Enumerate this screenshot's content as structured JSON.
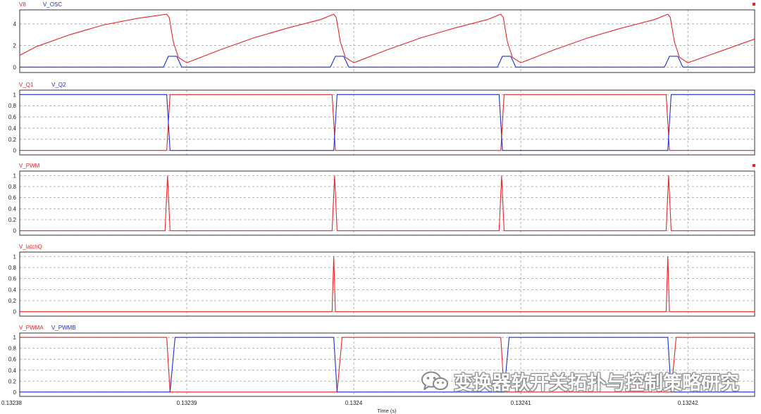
{
  "colors": {
    "red": "#e8262a",
    "blue": "#1f2fd4",
    "grid": "#9a9a9a",
    "axis": "#333333"
  },
  "x_axis": {
    "label": "Time (s)",
    "ticks": [
      "0.13238",
      "0.13239",
      "0.1324",
      "0.13241",
      "0.13242"
    ],
    "tick_values": [
      0.13238,
      0.13239,
      0.1324,
      0.13241,
      0.13242
    ],
    "range": [
      0.13238,
      0.132424
    ]
  },
  "watermark": {
    "text": "变换器软开关拓扑与控制策略研究",
    "icon": "wechat-icon"
  },
  "chart_data": [
    {
      "type": "line",
      "legend": [
        "V8",
        "V_OSC"
      ],
      "ylim": [
        -0.5,
        5.3
      ],
      "y_ticks": [
        "0",
        "2",
        "4"
      ],
      "y_tick_values": [
        0,
        2,
        4
      ],
      "series": [
        {
          "name": "V8",
          "color": "red",
          "points": [
            [
              0.13238,
              1.1
            ],
            [
              0.132381,
              1.9
            ],
            [
              0.132383,
              3.0
            ],
            [
              0.132385,
              3.9
            ],
            [
              0.132387,
              4.5
            ],
            [
              0.1323888,
              4.9
            ],
            [
              0.13238895,
              4.6
            ],
            [
              0.1323892,
              2.3
            ],
            [
              0.1323895,
              0.9
            ],
            [
              0.13239,
              0.4
            ],
            [
              0.132392,
              1.6
            ],
            [
              0.132394,
              2.7
            ],
            [
              0.132396,
              3.6
            ],
            [
              0.132398,
              4.4
            ],
            [
              0.1323988,
              4.9
            ],
            [
              0.13239895,
              4.6
            ],
            [
              0.1323992,
              2.3
            ],
            [
              0.1323995,
              0.9
            ],
            [
              0.1324,
              0.4
            ],
            [
              0.132402,
              1.6
            ],
            [
              0.132404,
              2.7
            ],
            [
              0.132406,
              3.6
            ],
            [
              0.132408,
              4.4
            ],
            [
              0.1324088,
              4.9
            ],
            [
              0.13240895,
              4.6
            ],
            [
              0.1324092,
              2.3
            ],
            [
              0.1324095,
              0.9
            ],
            [
              0.13241,
              0.4
            ],
            [
              0.132412,
              1.6
            ],
            [
              0.132414,
              2.7
            ],
            [
              0.132416,
              3.6
            ],
            [
              0.132418,
              4.4
            ],
            [
              0.1324188,
              4.9
            ],
            [
              0.13241895,
              4.6
            ],
            [
              0.1324192,
              2.3
            ],
            [
              0.1324195,
              0.9
            ],
            [
              0.13242,
              0.4
            ],
            [
              0.132422,
              1.5
            ],
            [
              0.132424,
              2.6
            ]
          ]
        },
        {
          "name": "V_OSC",
          "color": "blue",
          "points": [
            [
              0.13238,
              0
            ],
            [
              0.1323886,
              0
            ],
            [
              0.1323889,
              1.0
            ],
            [
              0.1323894,
              1.0
            ],
            [
              0.1323897,
              0
            ],
            [
              0.1323986,
              0
            ],
            [
              0.1323989,
              1.0
            ],
            [
              0.1323994,
              1.0
            ],
            [
              0.1323997,
              0
            ],
            [
              0.1324086,
              0
            ],
            [
              0.1324089,
              1.0
            ],
            [
              0.1324094,
              1.0
            ],
            [
              0.1324097,
              0
            ],
            [
              0.1324186,
              0
            ],
            [
              0.1324189,
              1.0
            ],
            [
              0.1324194,
              1.0
            ],
            [
              0.1324197,
              0
            ],
            [
              0.132424,
              0
            ]
          ]
        }
      ]
    },
    {
      "type": "line",
      "legend": [
        "V_Q1",
        "V_Q2"
      ],
      "ylim": [
        -0.08,
        1.08
      ],
      "y_ticks": [
        "0",
        "0.2",
        "0.4",
        "0.6",
        "0.8",
        "1"
      ],
      "y_tick_values": [
        0,
        0.2,
        0.4,
        0.6,
        0.8,
        1
      ],
      "series": [
        {
          "name": "V_Q1",
          "color": "red",
          "points": [
            [
              0.13238,
              0
            ],
            [
              0.1323888,
              0
            ],
            [
              0.132389,
              1
            ],
            [
              0.1323987,
              1
            ],
            [
              0.1323989,
              0
            ],
            [
              0.1324088,
              0
            ],
            [
              0.132409,
              1
            ],
            [
              0.1324187,
              1
            ],
            [
              0.1324189,
              0
            ],
            [
              0.132424,
              0
            ]
          ]
        },
        {
          "name": "V_Q2",
          "color": "blue",
          "points": [
            [
              0.13238,
              1
            ],
            [
              0.1323888,
              1
            ],
            [
              0.132389,
              0
            ],
            [
              0.1323988,
              0
            ],
            [
              0.132399,
              1
            ],
            [
              0.1324087,
              1
            ],
            [
              0.1324089,
              0
            ],
            [
              0.1324188,
              0
            ],
            [
              0.132419,
              1
            ],
            [
              0.132424,
              1
            ]
          ]
        }
      ]
    },
    {
      "type": "line",
      "legend": [
        "V_PWM"
      ],
      "ylim": [
        -0.08,
        1.08
      ],
      "y_ticks": [
        "0",
        "0.2",
        "0.4",
        "0.6",
        "0.8",
        "1"
      ],
      "y_tick_values": [
        0,
        0.2,
        0.4,
        0.6,
        0.8,
        1
      ],
      "series": [
        {
          "name": "V_PWM",
          "color": "red",
          "points": [
            [
              0.13238,
              0
            ],
            [
              0.1323887,
              0
            ],
            [
              0.13238885,
              1
            ],
            [
              0.132389,
              0
            ],
            [
              0.1323987,
              0
            ],
            [
              0.13239885,
              1
            ],
            [
              0.132399,
              0
            ],
            [
              0.1324087,
              0
            ],
            [
              0.13240885,
              1
            ],
            [
              0.132409,
              0
            ],
            [
              0.1324187,
              0
            ],
            [
              0.13241885,
              1
            ],
            [
              0.132419,
              0
            ],
            [
              0.132424,
              0
            ]
          ]
        }
      ]
    },
    {
      "type": "line",
      "legend": [
        "V_latchQ"
      ],
      "ylim": [
        -0.08,
        1.08
      ],
      "y_ticks": [
        "0",
        "0.2",
        "0.4",
        "0.6",
        "0.8",
        "1"
      ],
      "y_tick_values": [
        0,
        0.2,
        0.4,
        0.6,
        0.8,
        1
      ],
      "series": [
        {
          "name": "V_latchQ",
          "color": "red",
          "points": [
            [
              0.13238,
              0
            ],
            [
              0.1323987,
              0
            ],
            [
              0.1323988,
              1
            ],
            [
              0.1323989,
              0
            ],
            [
              0.1324187,
              0
            ],
            [
              0.1324188,
              1
            ],
            [
              0.1324189,
              0
            ],
            [
              0.132424,
              0
            ]
          ]
        }
      ]
    },
    {
      "type": "line",
      "legend": [
        "V_PWMA",
        "V_PWMB"
      ],
      "ylim": [
        -0.08,
        1.08
      ],
      "y_ticks": [
        "0",
        "0.2",
        "0.4",
        "0.6",
        "0.8",
        "1"
      ],
      "y_tick_values": [
        0,
        0.2,
        0.4,
        0.6,
        0.8,
        1
      ],
      "series": [
        {
          "name": "V_PWMA",
          "color": "red",
          "points": [
            [
              0.13238,
              1
            ],
            [
              0.1323888,
              1
            ],
            [
              0.132389,
              0
            ],
            [
              0.132399,
              0
            ],
            [
              0.1323993,
              1
            ],
            [
              0.1324088,
              1
            ],
            [
              0.132409,
              0
            ],
            [
              0.132419,
              0
            ],
            [
              0.1324193,
              1
            ],
            [
              0.132424,
              1
            ]
          ]
        },
        {
          "name": "V_PWMB",
          "color": "blue",
          "points": [
            [
              0.13238,
              0
            ],
            [
              0.132389,
              0
            ],
            [
              0.1323893,
              1
            ],
            [
              0.1323988,
              1
            ],
            [
              0.132399,
              0
            ],
            [
              0.132409,
              0
            ],
            [
              0.1324093,
              1
            ],
            [
              0.1324188,
              1
            ],
            [
              0.132419,
              0
            ],
            [
              0.132424,
              0
            ]
          ]
        }
      ]
    }
  ]
}
